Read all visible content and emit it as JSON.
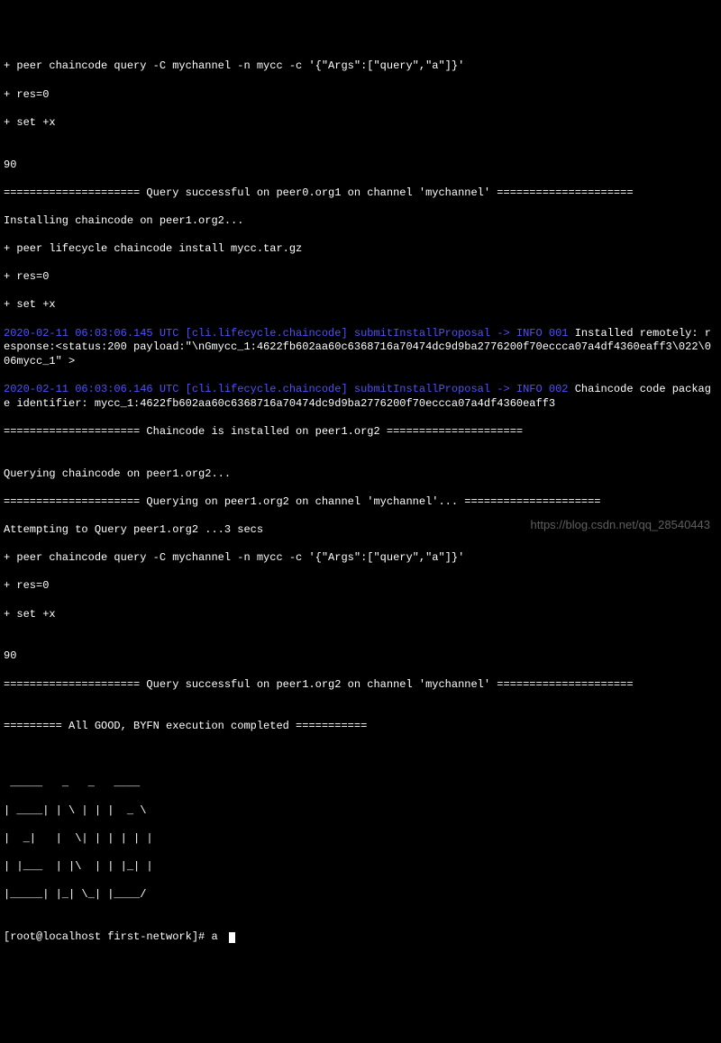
{
  "lines": {
    "l1": "+ peer chaincode query -C mychannel -n mycc -c '{\"Args\":[\"query\",\"a\"]}'",
    "l2": "+ res=0",
    "l3": "+ set +x",
    "l4": "",
    "l5": "90",
    "l6": "===================== Query successful on peer0.org1 on channel 'mychannel' =====================",
    "l7": "Installing chaincode on peer1.org2...",
    "l8": "+ peer lifecycle chaincode install mycc.tar.gz",
    "l9": "+ res=0",
    "l10": "+ set +x",
    "ts1": "2020-02-11 06:03:06.145 UTC [cli.lifecycle.chaincode] submitInstallProposal -> INFO 001",
    "l11": " Installed remotely: response:<status:200 payload:\"\\nGmycc_1:4622fb602aa60c6368716a70474dc9d9ba2776200f70eccca07a4df4360eaff3\\022\\006mycc_1\" >",
    "ts2": "2020-02-11 06:03:06.146 UTC [cli.lifecycle.chaincode] submitInstallProposal -> INFO 002",
    "l12": " Chaincode code package identifier: mycc_1:4622fb602aa60c6368716a70474dc9d9ba2776200f70eccca07a4df4360eaff3",
    "l13": "===================== Chaincode is installed on peer1.org2 =====================",
    "l14": "",
    "l15": "Querying chaincode on peer1.org2...",
    "l16": "===================== Querying on peer1.org2 on channel 'mychannel'... =====================",
    "l17": "Attempting to Query peer1.org2 ...3 secs",
    "l18": "+ peer chaincode query -C mychannel -n mycc -c '{\"Args\":[\"query\",\"a\"]}'",
    "l19": "+ res=0",
    "l20": "+ set +x",
    "l21": "",
    "l22": "90",
    "l23": "===================== Query successful on peer1.org2 on channel 'mychannel' =====================",
    "l24": "",
    "l25": "========= All GOOD, BYFN execution completed ===========",
    "l26": "",
    "l27": "",
    "a1": " _____   _   _   ____  ",
    "a2": "| ____| | \\ | | |  _ \\ ",
    "a3": "|  _|   |  \\| | | | | |",
    "a4": "| |___  | |\\  | | |_| |",
    "a5": "|_____| |_| \\_| |____/ ",
    "l28": ""
  },
  "prompt": "[root@localhost first-network]# ",
  "input_value": "a",
  "watermark": "https://blog.csdn.net/qq_28540443"
}
